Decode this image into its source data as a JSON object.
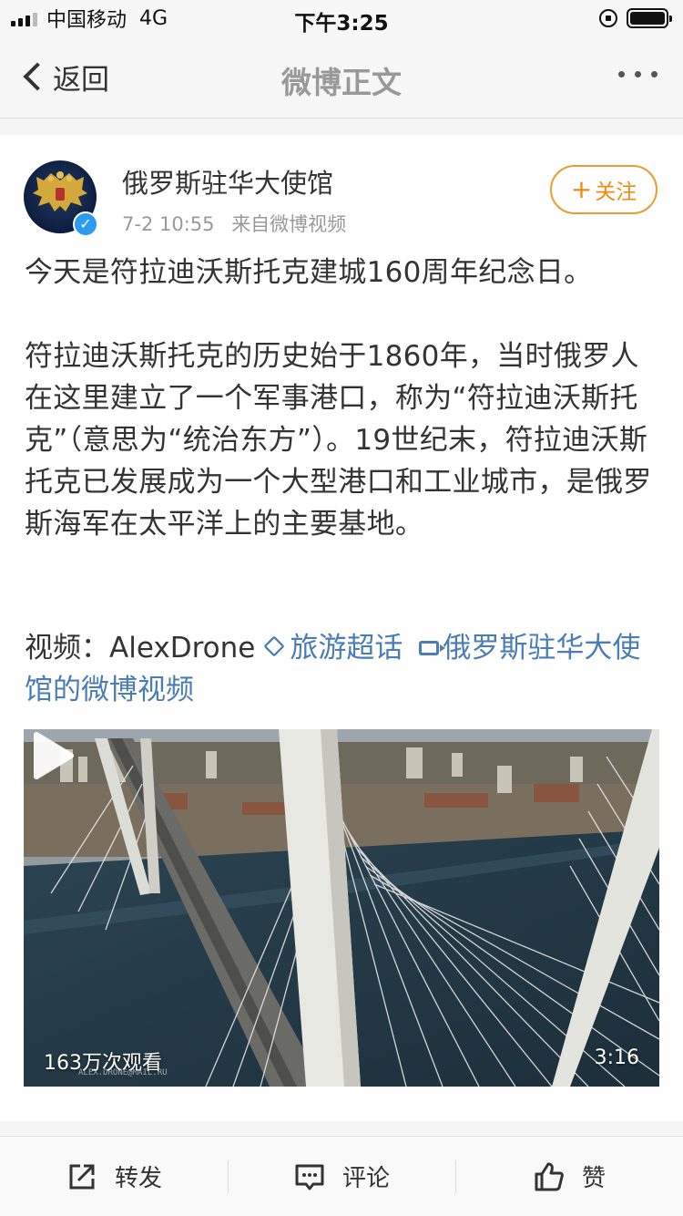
{
  "status_bar": {
    "carrier": "中国移动",
    "network": "4G",
    "time": "下午3:25"
  },
  "nav": {
    "back_label": "返回",
    "title": "微博正文"
  },
  "post": {
    "author": "俄罗斯驻华大使馆",
    "date": "7-2 10:55",
    "source": "来自微博视频",
    "follow_label": "关注",
    "paragraphs": [
      "今天是符拉迪沃斯托克建城160周年纪念日。",
      "符拉迪沃斯托克的历史始于1860年，当时俄罗人在这里建立了一个军事港口，称为“符拉迪沃斯托克”（意思为“统治东方”）。19世纪末，符拉迪沃斯托克已发展成为一个大型港口和工业城市，是俄罗斯海军在太平洋上的主要基地。"
    ],
    "links": {
      "prefix": "视频：AlexDrone",
      "topic": "旅游超话",
      "video_link": "俄罗斯驻华大使馆的微博视频"
    }
  },
  "video": {
    "views": "163万次观看",
    "duration": "3:16",
    "watermark": "ALEX.DRONE@MAIL.RU"
  },
  "toolbar": {
    "repost": "转发",
    "comment": "评论",
    "like": "赞"
  },
  "colors": {
    "accent_orange": "#f08a10",
    "link_blue": "#4a7cb6",
    "verified_blue": "#2d9bf0"
  }
}
